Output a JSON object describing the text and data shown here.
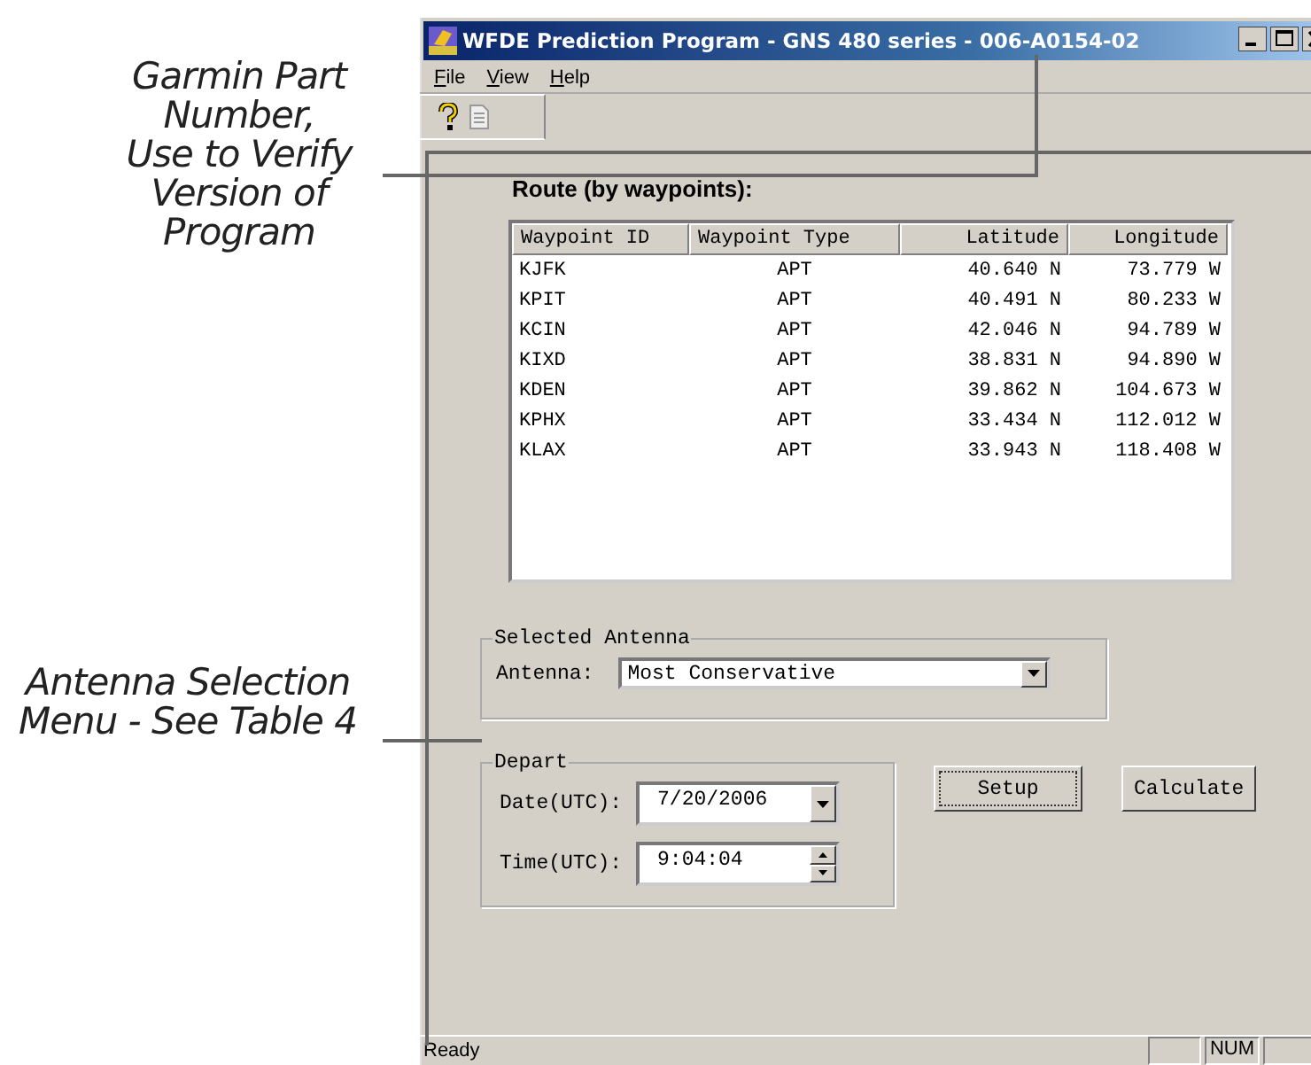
{
  "callouts": [
    "Garmin Part\nNumber,\nUse to Verify\nVersion of\nProgram",
    "Antenna Selection\nMenu - See Table 4"
  ],
  "window": {
    "title": "WFDE Prediction Program - GNS 480 series - 006-A0154-02"
  },
  "menu": [
    "File",
    "View",
    "Help"
  ],
  "route": {
    "label": "Route (by waypoints):",
    "columns": [
      "Waypoint ID",
      "Waypoint Type",
      "Latitude",
      "Longitude"
    ],
    "rows": [
      [
        "KJFK",
        "APT",
        "40.640 N",
        "73.779 W"
      ],
      [
        "KPIT",
        "APT",
        "40.491 N",
        "80.233 W"
      ],
      [
        "KCIN",
        "APT",
        "42.046 N",
        "94.789 W"
      ],
      [
        "KIXD",
        "APT",
        "38.831 N",
        "94.890 W"
      ],
      [
        "KDEN",
        "APT",
        "39.862 N",
        "104.673 W"
      ],
      [
        "KPHX",
        "APT",
        "33.434 N",
        "112.012 W"
      ],
      [
        "KLAX",
        "APT",
        "33.943 N",
        "118.408 W"
      ]
    ]
  },
  "antenna": {
    "group": "Selected Antenna",
    "label": "Antenna:",
    "value": "Most Conservative"
  },
  "depart": {
    "group": "Depart",
    "date_label": "Date(UTC):",
    "date": "7/20/2006",
    "time_label": "Time(UTC):",
    "time": "9:04:04"
  },
  "buttons": [
    "Setup",
    "Calculate"
  ],
  "status_bar": {
    "text": "Ready",
    "indicator": "NUM"
  }
}
